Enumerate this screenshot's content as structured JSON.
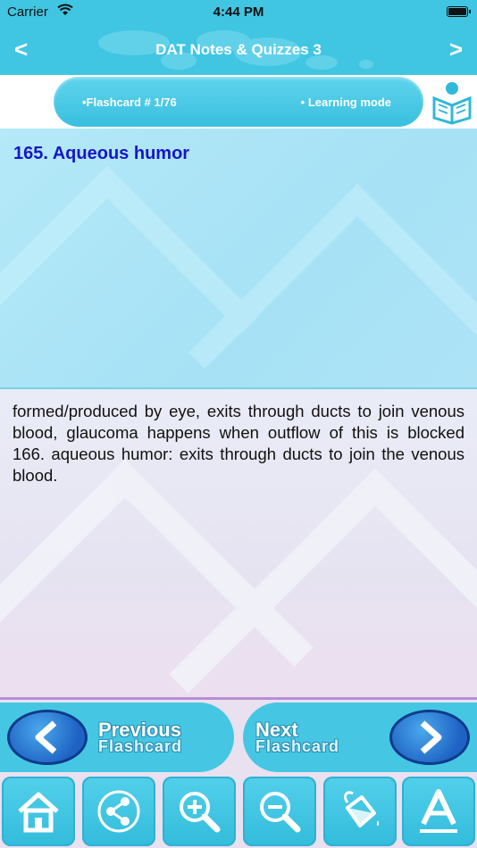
{
  "status_bar": {
    "carrier": "Carrier",
    "time": "4:44 PM"
  },
  "nav": {
    "title": "DAT Notes & Quizzes 3",
    "back_label": "<",
    "forward_label": ">"
  },
  "info": {
    "flashcard_label": "•Flashcard #  1/76",
    "mode_label": "• Learning mode"
  },
  "question": {
    "text": "165. Aqueous humor"
  },
  "answer": {
    "text": "formed/produced by eye, exits through ducts to join venous blood, glaucoma happens when outflow of this is blocked 166. aqueous humor: exits through ducts to join the venous blood."
  },
  "buttons": {
    "previous": {
      "line1": "Previous",
      "line2": "Flashcard"
    },
    "next": {
      "line1": "Next",
      "line2": "Flashcard"
    }
  },
  "toolbar": {
    "icons": [
      "home-icon",
      "share-icon",
      "zoom-in-icon",
      "zoom-out-icon",
      "paint-bucket-icon",
      "font-icon"
    ]
  },
  "colors": {
    "accent": "#40c6e2",
    "question_text": "#1616c8",
    "nav_button": "#1e62c4"
  }
}
